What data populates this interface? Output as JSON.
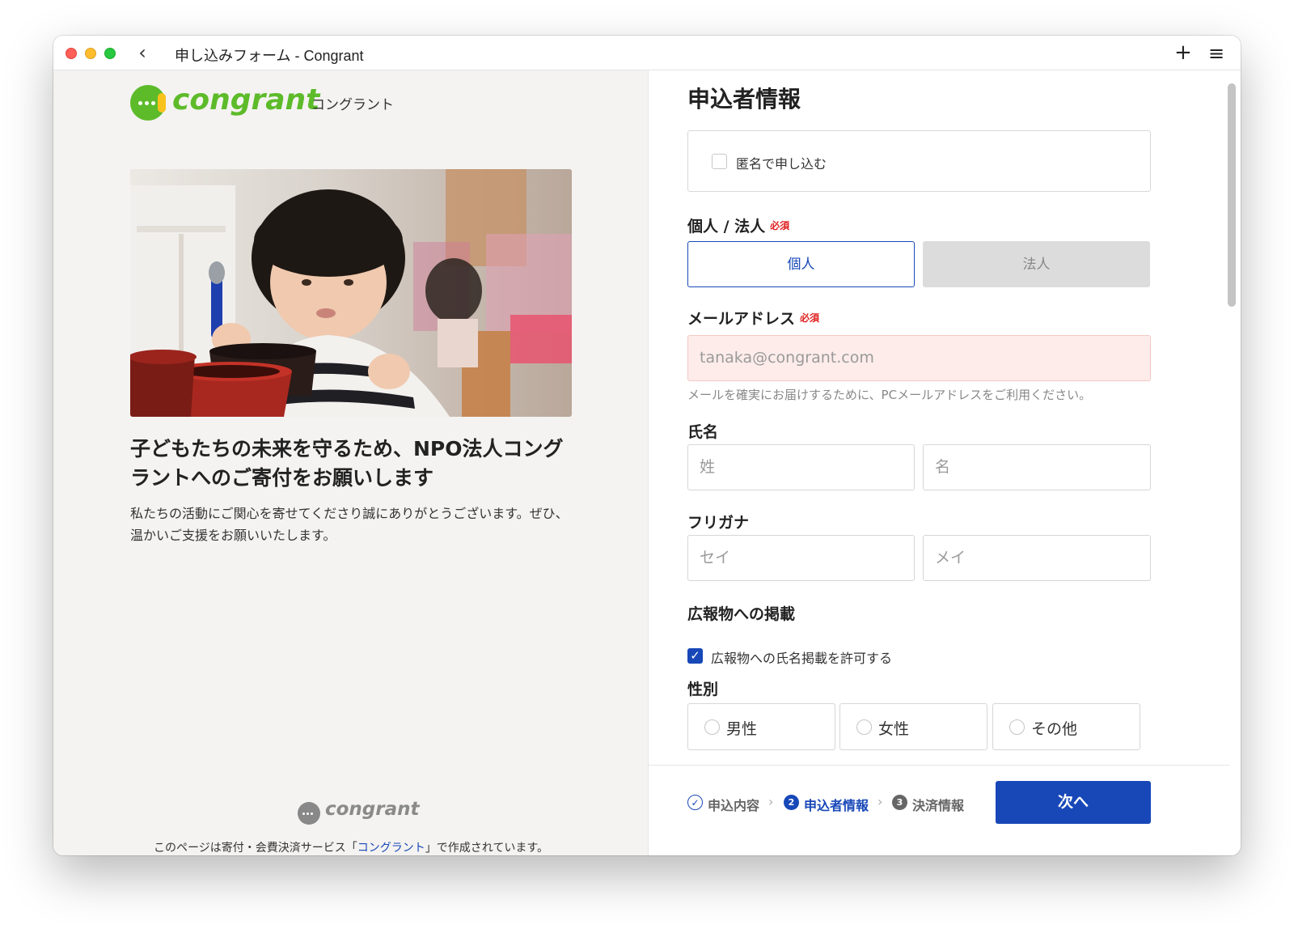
{
  "window": {
    "title": "申し込みフォーム - Congrant"
  },
  "toolbar": {
    "back_icon": "chevron-left-icon",
    "new_tab_icon": "plus-icon",
    "menu_icon": "hamburger-menu-icon"
  },
  "left": {
    "logo_word": "congrant",
    "logo_kana": "コングラント",
    "headline": "子どもたちの未来を守るため、NPO法人コングラントへのご寄付をお願いします",
    "description": "私たちの活動にご関心を寄せてくださり誠にありがとうございます。ぜひ、温かいご支援をお願いいたします。",
    "footer_logo": "congrant",
    "footer_note_prefix": "このページは寄付・会費決済サービス「",
    "footer_note_link": "コングラント",
    "footer_note_suffix": "」で作成されています。"
  },
  "form": {
    "title": "申込者情報",
    "anonymous_label": "匿名で申し込む",
    "anonymous_checked": false,
    "entity_label": "個人 / 法人",
    "required_mark": "必須",
    "entity_options": [
      "個人",
      "法人"
    ],
    "entity_selected": "個人",
    "email_label": "メールアドレス",
    "email_placeholder": "tanaka@congrant.com",
    "email_hint": "メールを確実にお届けするために、PCメールアドレスをご利用ください。",
    "name_label": "氏名",
    "last_name_placeholder": "姓",
    "first_name_placeholder": "名",
    "kana_label": "フリガナ",
    "last_kana_placeholder": "セイ",
    "first_kana_placeholder": "メイ",
    "pr_label": "広報物への掲載",
    "pr_checkbox_label": "広報物への氏名掲載を許可する",
    "pr_checked": true,
    "gender_label": "性別",
    "gender_options": [
      "男性",
      "女性",
      "その他"
    ]
  },
  "steps": {
    "items": [
      "申込内容",
      "申込者情報",
      "決済情報"
    ],
    "current": 2
  },
  "next_button": "次へ",
  "colors": {
    "brand_green": "#5dbb2a",
    "brand_yellow": "#f7c21b",
    "primary_blue": "#1848b8",
    "required_red": "#e02020",
    "error_bg": "#fdecea"
  }
}
